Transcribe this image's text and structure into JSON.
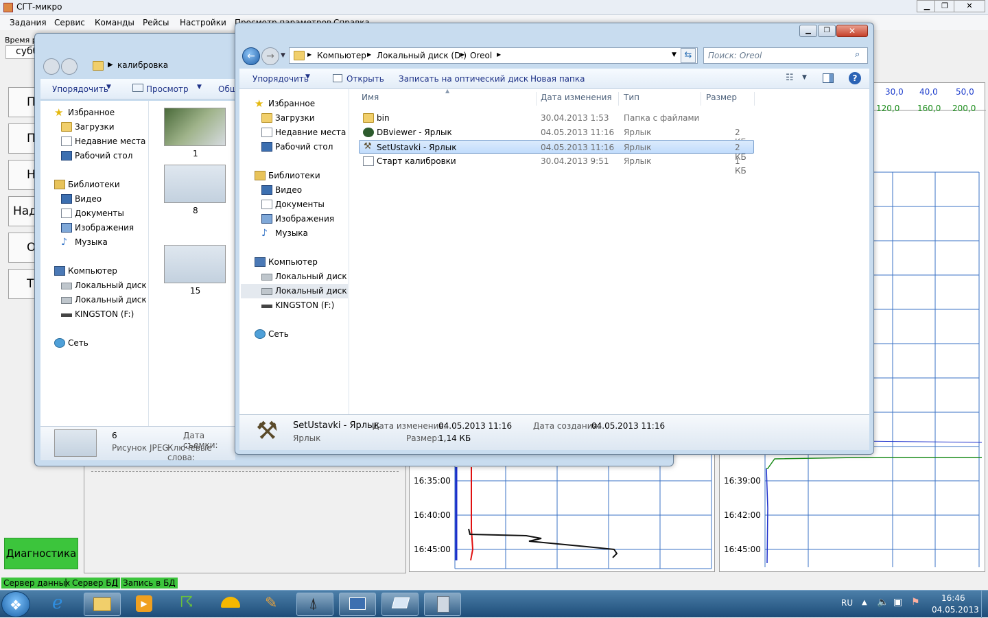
{
  "app": {
    "title": "СГТ-микро",
    "menu": [
      "Задания",
      "Сервис",
      "Команды",
      "Рейсы",
      "Настройки",
      "Просмотр параметров",
      "Справка"
    ],
    "time_label": "Время регистрации",
    "day_text": "субб",
    "left_buttons": [
      "П",
      "По",
      "На",
      "Над",
      "О",
      "Тал"
    ],
    "diag_label": "Диагностика",
    "status_badges": [
      "Сервер данных",
      "Сервер БД",
      "Запись в БД"
    ],
    "left_chart_times": [
      "16:35:00",
      "16:40:00",
      "16:45:00"
    ],
    "right_chart_times": [
      "16:39:00",
      "16:42:00",
      "16:45:00"
    ],
    "top_scale_a": [
      "30,0",
      "40,0",
      "50,0"
    ],
    "top_scale_b": [
      "120,0",
      "160,0",
      "200,0"
    ],
    "colors": {
      "green": "#3cc53c",
      "blue_line": "#1c2fcc",
      "red_line": "#e01010",
      "green_line": "#1a8c1a"
    }
  },
  "back_explorer": {
    "path": "калибровка",
    "toolbar": [
      "Упорядочить",
      "Просмотр",
      "Общ"
    ],
    "nav": {
      "favorites": "Избранное",
      "fav_items": [
        "Загрузки",
        "Недавние места",
        "Рабочий стол"
      ],
      "libraries": "Библиотеки",
      "lib_items": [
        "Видео",
        "Документы",
        "Изображения",
        "Музыка"
      ],
      "computer": "Компьютер",
      "comp_items": [
        "Локальный диск (C",
        "Локальный диск (D",
        "KINGSTON (F:)"
      ],
      "network": "Сеть"
    },
    "thumbs": [
      "1",
      "8",
      "15"
    ],
    "details": {
      "name": "6",
      "type": "Рисунок JPEG",
      "date_label": "Дата съемки:",
      "tags_label": "Ключевые слова:"
    }
  },
  "front_explorer": {
    "breadcrumb": [
      "Компьютер",
      "Локальный диск (D:)",
      "Oreol"
    ],
    "search_placeholder": "Поиск: Oreol",
    "toolbar": {
      "organize": "Упорядочить",
      "open": "Открыть",
      "burn": "Записать на оптический диск",
      "new_folder": "Новая папка"
    },
    "nav": {
      "favorites": "Избранное",
      "fav_items": [
        "Загрузки",
        "Недавние места",
        "Рабочий стол"
      ],
      "libraries": "Библиотеки",
      "lib_items": [
        "Видео",
        "Документы",
        "Изображения",
        "Музыка"
      ],
      "computer": "Компьютер",
      "comp_items": [
        "Локальный диск (C",
        "Локальный диск (D",
        "KINGSTON (F:)"
      ],
      "network": "Сеть"
    },
    "columns": [
      "Имя",
      "Дата изменения",
      "Тип",
      "Размер"
    ],
    "files": [
      {
        "name": "bin",
        "date": "30.04.2013 1:53",
        "type": "Папка с файлами",
        "size": ""
      },
      {
        "name": "DBviewer - Ярлык",
        "date": "04.05.2013 11:16",
        "type": "Ярлык",
        "size": "2 КБ"
      },
      {
        "name": "SetUstavki - Ярлык",
        "date": "04.05.2013 11:16",
        "type": "Ярлык",
        "size": "2 КБ"
      },
      {
        "name": "Старт калибровки",
        "date": "30.04.2013 9:51",
        "type": "Ярлык",
        "size": "1 КБ"
      }
    ],
    "details": {
      "name": "SetUstavki - Ярлык",
      "type": "Ярлык",
      "modified_label": "Дата изменения:",
      "modified": "04.05.2013 11:16",
      "created_label": "Дата создания:",
      "created": "04.05.2013 11:16",
      "size_label": "Размер:",
      "size": "1,14 КБ"
    }
  },
  "taskbar": {
    "lang": "RU",
    "time": "16:46",
    "date": "04.05.2013"
  }
}
